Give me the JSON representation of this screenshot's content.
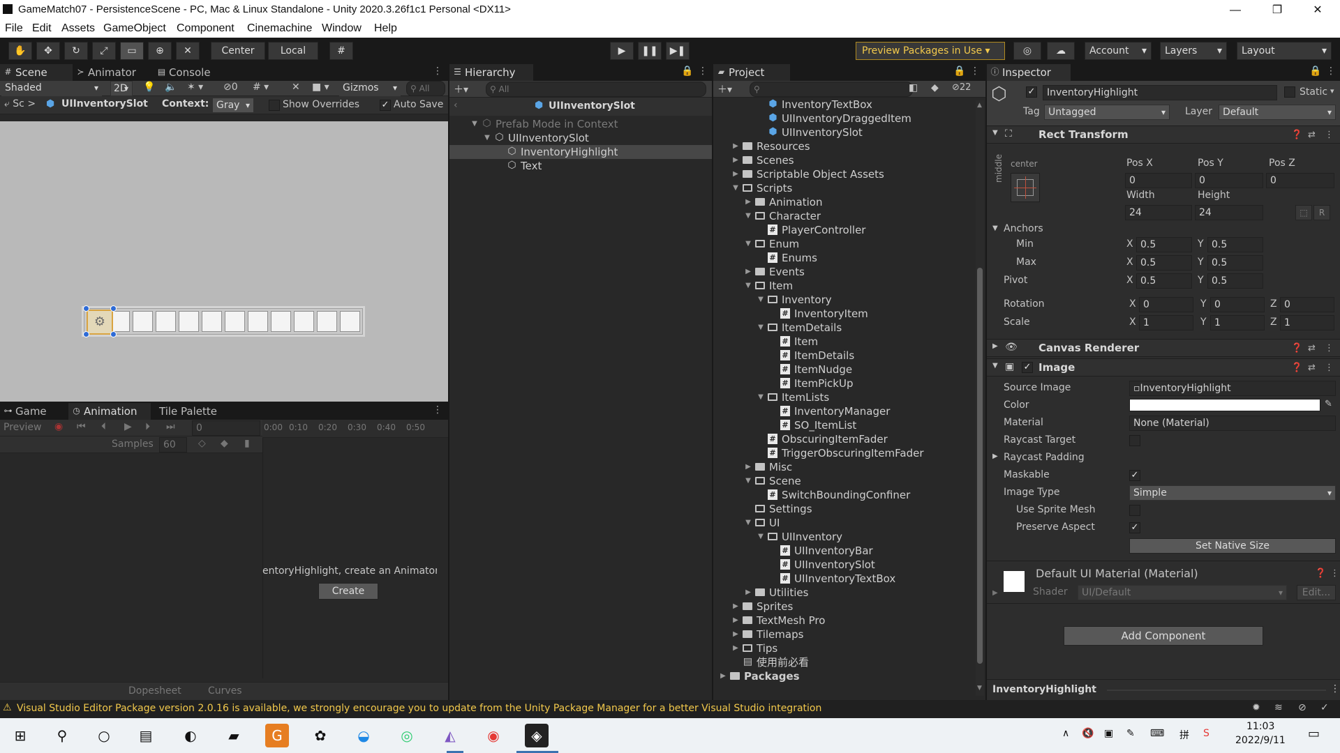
{
  "title": "GameMatch07 - PersistenceScene - PC, Mac & Linux Standalone - Unity 2020.3.26f1c1 Personal <DX11>",
  "menu": [
    "File",
    "Edit",
    "Assets",
    "GameObject",
    "Component",
    "Cinemachine",
    "Window",
    "Help"
  ],
  "toolbar": {
    "pivot": "Center",
    "space": "Local",
    "preview_packages": "Preview Packages in Use",
    "account": "Account",
    "layers": "Layers",
    "layout": "Layout"
  },
  "scene": {
    "tabs": [
      "Scene",
      "Animator",
      "Console"
    ],
    "shading": "Shaded",
    "mode_2d": "2D",
    "hidden_count": "0",
    "gizmos": "Gizmos",
    "search": "All",
    "breadcrumb_root": "Sc",
    "breadcrumb_item": "UIInventorySlot",
    "context_label": "Context:",
    "context_value": "Gray",
    "show_overrides": "Show Overrides",
    "auto_save": "Auto Save"
  },
  "animation": {
    "tabs": [
      "Game",
      "Animation",
      "Tile Palette"
    ],
    "preview": "Preview",
    "frame": "0",
    "samples_label": "Samples",
    "samples": "60",
    "ticks": [
      "0:00",
      "0:10",
      "0:20",
      "0:30",
      "0:40",
      "0:50"
    ],
    "message": "entoryHighlight, create an Animator",
    "create": "Create",
    "bottom_tabs": [
      "Dopesheet",
      "Curves"
    ]
  },
  "hierarchy": {
    "tab": "Hierarchy",
    "search": "All",
    "header": "UIInventorySlot",
    "items": [
      {
        "label": "Prefab Mode in Context",
        "depth": 0,
        "arrow": "▼",
        "kind": "ctx"
      },
      {
        "label": "UIInventorySlot",
        "depth": 1,
        "arrow": "▼",
        "kind": "prefab"
      },
      {
        "label": "InventoryHighlight",
        "depth": 2,
        "arrow": "",
        "kind": "prefab",
        "selected": true
      },
      {
        "label": "Text",
        "depth": 2,
        "arrow": "",
        "kind": "prefab"
      }
    ]
  },
  "project": {
    "tab": "Project",
    "hidden_count": "22",
    "items": [
      {
        "label": "InventoryTextBox",
        "depth": 3,
        "arrow": "",
        "kind": "cube"
      },
      {
        "label": "UIInventoryDraggedItem",
        "depth": 3,
        "arrow": "",
        "kind": "cube"
      },
      {
        "label": "UIInventorySlot",
        "depth": 3,
        "arrow": "",
        "kind": "cube"
      },
      {
        "label": "Resources",
        "depth": 1,
        "arrow": "▶",
        "kind": "folder"
      },
      {
        "label": "Scenes",
        "depth": 1,
        "arrow": "▶",
        "kind": "folder"
      },
      {
        "label": "Scriptable Object Assets",
        "depth": 1,
        "arrow": "▶",
        "kind": "folder"
      },
      {
        "label": "Scripts",
        "depth": 1,
        "arrow": "▼",
        "kind": "folder-open"
      },
      {
        "label": "Animation",
        "depth": 2,
        "arrow": "▶",
        "kind": "folder"
      },
      {
        "label": "Character",
        "depth": 2,
        "arrow": "▼",
        "kind": "folder-open"
      },
      {
        "label": "PlayerController",
        "depth": 3,
        "arrow": "",
        "kind": "script"
      },
      {
        "label": "Enum",
        "depth": 2,
        "arrow": "▼",
        "kind": "folder-open"
      },
      {
        "label": "Enums",
        "depth": 3,
        "arrow": "",
        "kind": "script"
      },
      {
        "label": "Events",
        "depth": 2,
        "arrow": "▶",
        "kind": "folder"
      },
      {
        "label": "Item",
        "depth": 2,
        "arrow": "▼",
        "kind": "folder-open"
      },
      {
        "label": "Inventory",
        "depth": 3,
        "arrow": "▼",
        "kind": "folder-open"
      },
      {
        "label": "InventoryItem",
        "depth": 4,
        "arrow": "",
        "kind": "script"
      },
      {
        "label": "ItemDetails",
        "depth": 3,
        "arrow": "▼",
        "kind": "folder-open"
      },
      {
        "label": "Item",
        "depth": 4,
        "arrow": "",
        "kind": "script"
      },
      {
        "label": "ItemDetails",
        "depth": 4,
        "arrow": "",
        "kind": "script"
      },
      {
        "label": "ItemNudge",
        "depth": 4,
        "arrow": "",
        "kind": "script"
      },
      {
        "label": "ItemPickUp",
        "depth": 4,
        "arrow": "",
        "kind": "script"
      },
      {
        "label": "ItemLists",
        "depth": 3,
        "arrow": "▼",
        "kind": "folder-open"
      },
      {
        "label": "InventoryManager",
        "depth": 4,
        "arrow": "",
        "kind": "script"
      },
      {
        "label": "SO_ItemList",
        "depth": 4,
        "arrow": "",
        "kind": "script"
      },
      {
        "label": "ObscuringItemFader",
        "depth": 3,
        "arrow": "",
        "kind": "script"
      },
      {
        "label": "TriggerObscuringItemFader",
        "depth": 3,
        "arrow": "",
        "kind": "script"
      },
      {
        "label": "Misc",
        "depth": 2,
        "arrow": "▶",
        "kind": "folder"
      },
      {
        "label": "Scene",
        "depth": 2,
        "arrow": "▼",
        "kind": "folder-open"
      },
      {
        "label": "SwitchBoundingConfiner",
        "depth": 3,
        "arrow": "",
        "kind": "script"
      },
      {
        "label": "Settings",
        "depth": 2,
        "arrow": "",
        "kind": "folder-open"
      },
      {
        "label": "UI",
        "depth": 2,
        "arrow": "▼",
        "kind": "folder-open"
      },
      {
        "label": "UIInventory",
        "depth": 3,
        "arrow": "▼",
        "kind": "folder-open"
      },
      {
        "label": "UIInventoryBar",
        "depth": 4,
        "arrow": "",
        "kind": "script"
      },
      {
        "label": "UIInventorySlot",
        "depth": 4,
        "arrow": "",
        "kind": "script"
      },
      {
        "label": "UIInventoryTextBox",
        "depth": 4,
        "arrow": "",
        "kind": "script"
      },
      {
        "label": "Utilities",
        "depth": 2,
        "arrow": "▶",
        "kind": "folder"
      },
      {
        "label": "Sprites",
        "depth": 1,
        "arrow": "▶",
        "kind": "folder"
      },
      {
        "label": "TextMesh Pro",
        "depth": 1,
        "arrow": "▶",
        "kind": "folder"
      },
      {
        "label": "Tilemaps",
        "depth": 1,
        "arrow": "▶",
        "kind": "folder"
      },
      {
        "label": "Tips",
        "depth": 1,
        "arrow": "▶",
        "kind": "folder-open"
      },
      {
        "label": "使用前必看",
        "depth": 1,
        "arrow": "",
        "kind": "doc"
      },
      {
        "label": "Packages",
        "depth": 0,
        "arrow": "▶",
        "kind": "folder",
        "bold": true
      }
    ]
  },
  "inspector": {
    "tab": "Inspector",
    "object_name": "InventoryHighlight",
    "static": "Static",
    "tag_label": "Tag",
    "tag": "Untagged",
    "layer_label": "Layer",
    "layer": "Default",
    "rect_title": "Rect Transform",
    "anchor_top": "center",
    "anchor_side": "middle",
    "pos_x_label": "Pos X",
    "pos_y_label": "Pos Y",
    "pos_z_label": "Pos Z",
    "pos_x": "0",
    "pos_y": "0",
    "pos_z": "0",
    "width_label": "Width",
    "height_label": "Height",
    "width": "24",
    "height": "24",
    "r_btn": "R",
    "anchors": "Anchors",
    "min": "Min",
    "max": "Max",
    "pivot": "Pivot",
    "rotation": "Rotation",
    "scale": "Scale",
    "x": "X",
    "y": "Y",
    "z": "Z",
    "min_x": "0.5",
    "min_y": "0.5",
    "max_x": "0.5",
    "max_y": "0.5",
    "pivot_x": "0.5",
    "pivot_y": "0.5",
    "rot_x": "0",
    "rot_y": "0",
    "rot_z": "0",
    "scale_x": "1",
    "scale_y": "1",
    "scale_z": "1",
    "canvas_renderer": "Canvas Renderer",
    "image": "Image",
    "source_image_label": "Source Image",
    "source_image": "InventoryHighlight",
    "color_label": "Color",
    "material_label": "Material",
    "material": "None (Material)",
    "raycast_target": "Raycast Target",
    "raycast_padding": "Raycast Padding",
    "maskable": "Maskable",
    "image_type_label": "Image Type",
    "image_type": "Simple",
    "use_sprite_mesh": "Use Sprite Mesh",
    "preserve_aspect": "Preserve Aspect",
    "set_native_size": "Set Native Size",
    "material_header": "Default UI Material (Material)",
    "shader_label": "Shader",
    "shader": "UI/Default",
    "edit": "Edit...",
    "add_component": "Add Component",
    "footer": "InventoryHighlight"
  },
  "status": {
    "message": "Visual Studio Editor Package version 2.0.16 is available, we strongly encourage you to update from the Unity Package Manager for a better Visual Studio integration"
  },
  "clock": {
    "time": "11:03",
    "date": "2022/9/11"
  },
  "colors": {
    "accent": "#3a72b0",
    "selection": "#2c5d87",
    "warning": "#f2c94c",
    "panel": "#282828"
  }
}
